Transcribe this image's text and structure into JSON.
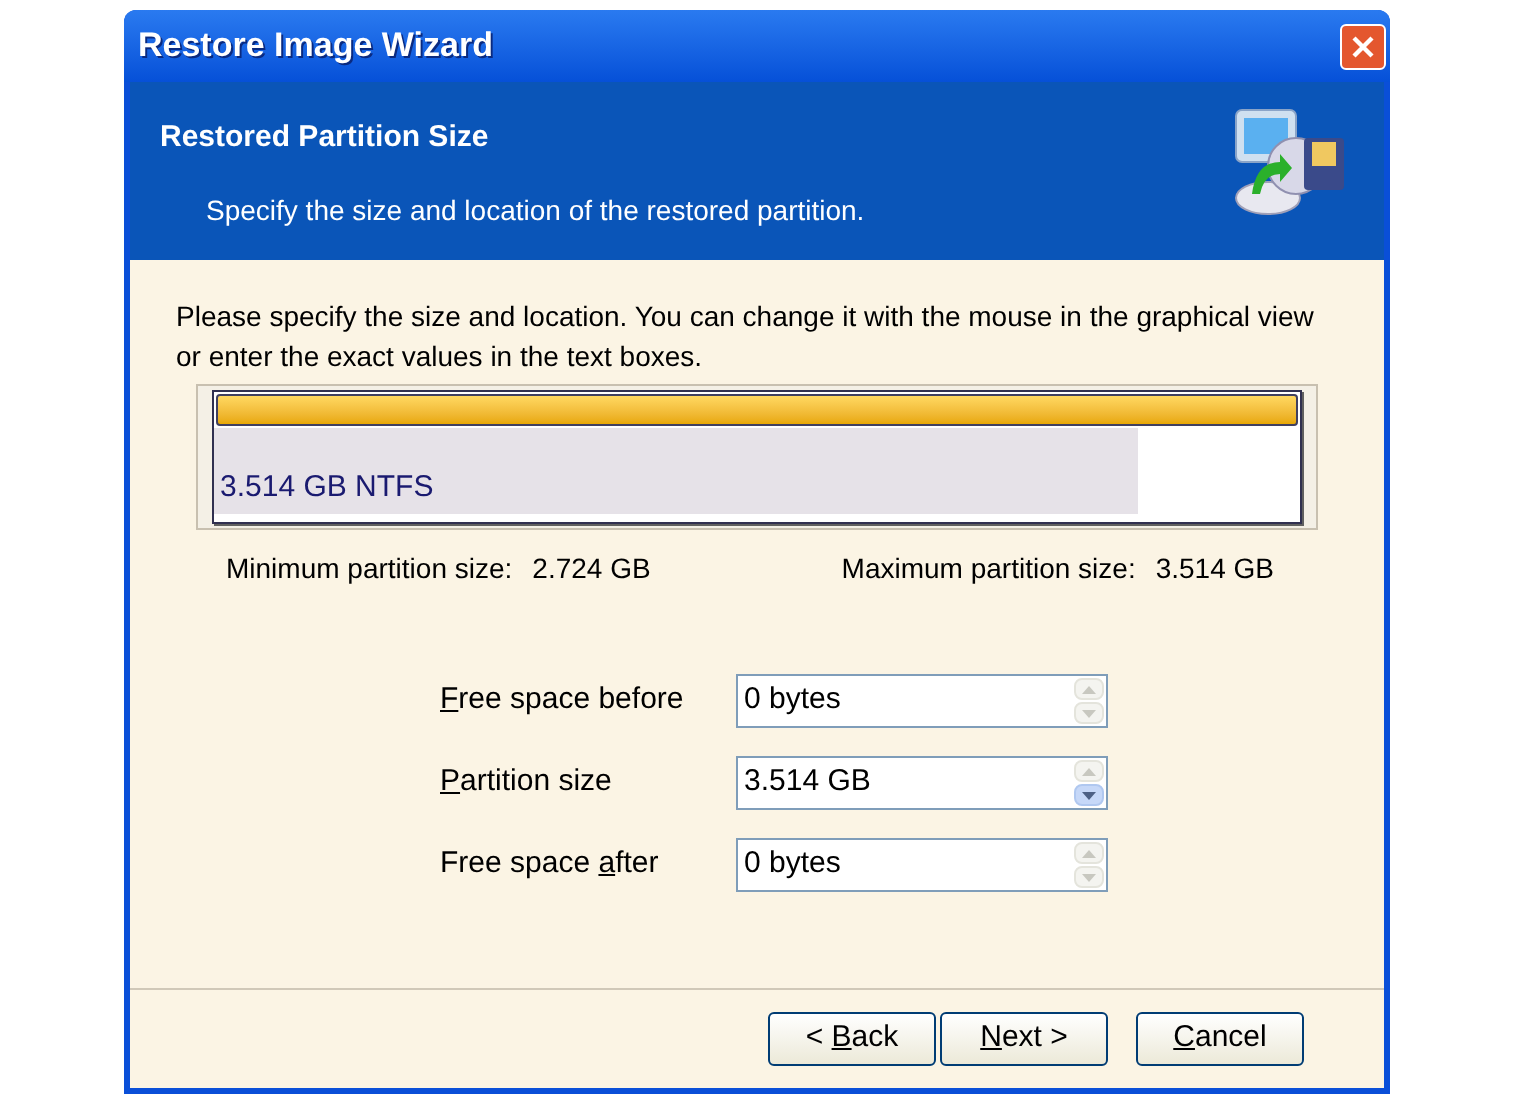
{
  "window": {
    "title": "Restore Image Wizard"
  },
  "header": {
    "title": "Restored Partition Size",
    "subtitle": "Specify the size and location of the restored partition."
  },
  "instructions": "Please specify the size and location. You can change it with the mouse in the graphical view or enter the exact values in the text boxes.",
  "partition": {
    "label": "3.514 GB  NTFS",
    "level": 0.85
  },
  "limits": [
    {
      "label": "Minimum partition size:",
      "value": "2.724 GB"
    },
    {
      "label": "Maximum partition size:",
      "value": "3.514 GB"
    }
  ],
  "fields": [
    {
      "key": "F",
      "post": "ree space before",
      "value": "0 bytes",
      "up_enabled": false,
      "down_enabled": false
    },
    {
      "key": "P",
      "post": "artition size",
      "value": "3.514 GB",
      "up_enabled": false,
      "down_enabled": true
    },
    {
      "pre": "Free space ",
      "key": "a",
      "post": "fter",
      "value": "0 bytes",
      "up_enabled": false,
      "down_enabled": false
    }
  ],
  "buttons": [
    {
      "pre": "< ",
      "key": "B",
      "post": "ack"
    },
    {
      "key": "N",
      "post": "ext >"
    },
    {
      "key": "C",
      "post": "ancel"
    }
  ]
}
